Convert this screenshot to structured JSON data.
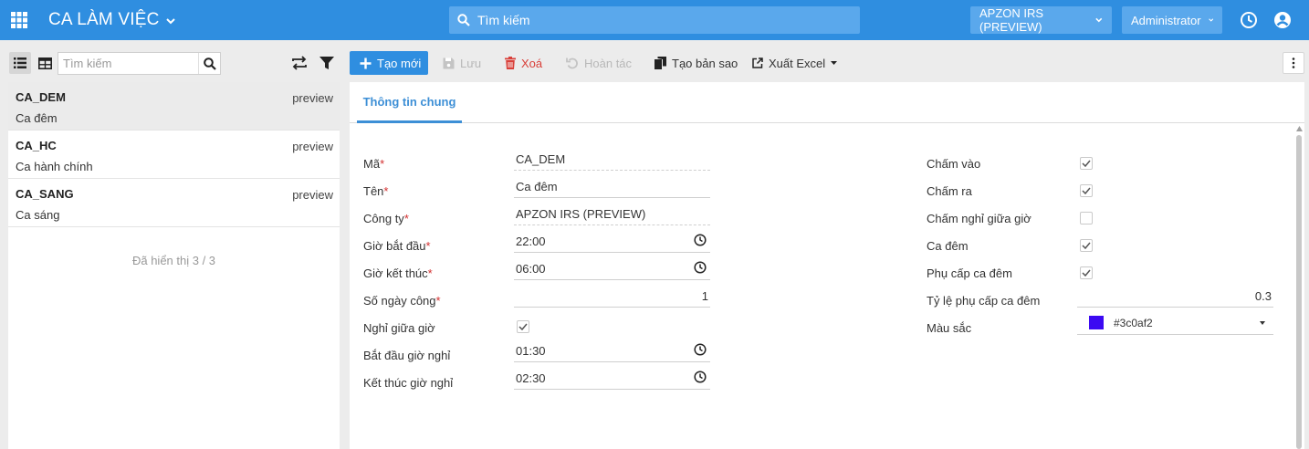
{
  "header": {
    "app_title": "CA LÀM VIỆC",
    "search_placeholder": "Tìm kiếm",
    "company_menu": "APZON IRS (PREVIEW)",
    "user_menu": "Administrator",
    "brand_color": "#2f8ee0"
  },
  "left": {
    "search_placeholder": "Tìm kiếm",
    "items": [
      {
        "code": "CA_DEM",
        "name": "Ca đêm",
        "tag": "preview",
        "selected": true
      },
      {
        "code": "CA_HC",
        "name": "Ca hành chính",
        "tag": "preview",
        "selected": false
      },
      {
        "code": "CA_SANG",
        "name": "Ca sáng",
        "tag": "preview",
        "selected": false
      }
    ],
    "footer": "Đã hiển thị 3 / 3"
  },
  "toolbar": {
    "new_label": "Tạo mới",
    "save_label": "Lưu",
    "delete_label": "Xoá",
    "undo_label": "Hoàn tác",
    "copy_label": "Tạo bản sao",
    "export_label": "Xuất Excel"
  },
  "tabs": {
    "general": "Thông tin chung"
  },
  "form": {
    "ma": {
      "label": "Mã",
      "required": "*",
      "value": "CA_DEM"
    },
    "ten": {
      "label": "Tên",
      "required": "*",
      "value": "Ca đêm"
    },
    "cong_ty": {
      "label": "Công ty",
      "required": "*",
      "value": "APZON IRS (PREVIEW)"
    },
    "gio_bat_dau": {
      "label": "Giờ bắt đầu",
      "required": "*",
      "value": "22:00"
    },
    "gio_ket_thuc": {
      "label": "Giờ kết thúc",
      "required": "*",
      "value": "06:00"
    },
    "so_ngay_cong": {
      "label": "Số ngày công",
      "required": "*",
      "value": "1"
    },
    "nghi_giua_gio": {
      "label": "Nghỉ giữa giờ",
      "checked": true
    },
    "bat_dau_nghi": {
      "label": "Bắt đầu giờ nghỉ",
      "value": "01:30"
    },
    "ket_thuc_nghi": {
      "label": "Kết thúc giờ nghỉ",
      "value": "02:30"
    },
    "cham_vao": {
      "label": "Chấm vào",
      "checked": true
    },
    "cham_ra": {
      "label": "Chấm ra",
      "checked": true
    },
    "cham_nghi_giua_gio": {
      "label": "Chấm nghỉ giữa giờ",
      "checked": false
    },
    "ca_dem": {
      "label": "Ca đêm",
      "checked": true
    },
    "phu_cap_ca_dem": {
      "label": "Phụ cấp ca đêm",
      "checked": true
    },
    "ty_le_phu_cap": {
      "label": "Tỷ lệ phụ cấp ca đêm",
      "value": "0.3"
    },
    "mau_sac": {
      "label": "Màu sắc",
      "value": "#3c0af2",
      "swatch_color": "#3c0af2"
    }
  }
}
